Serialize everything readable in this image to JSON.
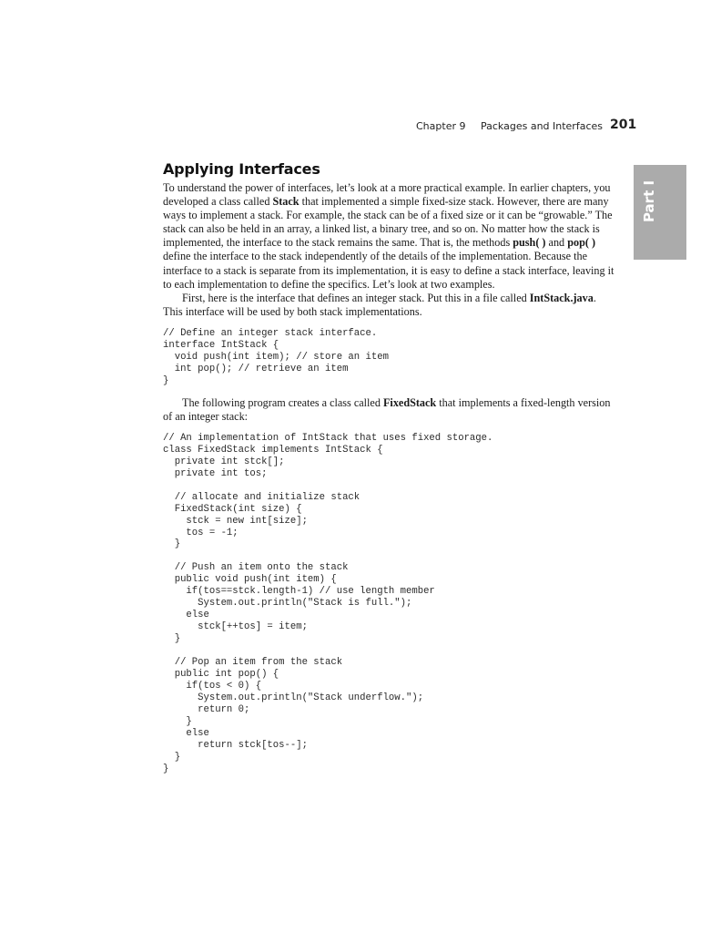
{
  "running_head": {
    "chapter": "Chapter 9",
    "title": "Packages and Interfaces",
    "page_number": "201"
  },
  "part_tab": "Part I",
  "section": {
    "heading": "Applying Interfaces",
    "p1": {
      "a": "To understand the power of interfaces, let’s look at a more practical example. In earlier chapters, you developed a class called ",
      "b": "Stack",
      "c": " that implemented a simple fixed-size stack. However, there are many ways to implement a stack. For example, the stack can be of a fixed size or it can be “growable.” The stack can also be held in an array, a linked list, a binary tree, and so on. No matter how the stack is implemented, the interface to the stack remains the same. That is, the methods ",
      "d": "push( )",
      "e": " and ",
      "f": "pop( )",
      "g": " define the interface to the stack independently of the details of the implementation. Because the interface to a stack is separate from its implementation, it is easy to define a stack interface, leaving it to each implementation to define the specifics. Let’s look at two examples."
    },
    "p2": {
      "a": "First, here is the interface that defines an integer stack. Put this in a file called ",
      "b": "IntStack.java",
      "c": ". This interface will be used by both stack implementations."
    },
    "code1": "// Define an integer stack interface.\ninterface IntStack {\n  void push(int item); // store an item\n  int pop(); // retrieve an item\n}",
    "p3": {
      "a": "The following program creates a class called ",
      "b": "FixedStack",
      "c": " that implements a fixed-length version of an integer stack:"
    },
    "code2": "// An implementation of IntStack that uses fixed storage.\nclass FixedStack implements IntStack {\n  private int stck[];\n  private int tos;\n\n  // allocate and initialize stack\n  FixedStack(int size) {\n    stck = new int[size];\n    tos = -1;\n  }\n\n  // Push an item onto the stack\n  public void push(int item) {\n    if(tos==stck.length-1) // use length member\n      System.out.println(\"Stack is full.\");\n    else\n      stck[++tos] = item;\n  }\n\n  // Pop an item from the stack\n  public int pop() {\n    if(tos < 0) {\n      System.out.println(\"Stack underflow.\");\n      return 0;\n    }\n    else\n      return stck[tos--];\n  }\n}"
  }
}
